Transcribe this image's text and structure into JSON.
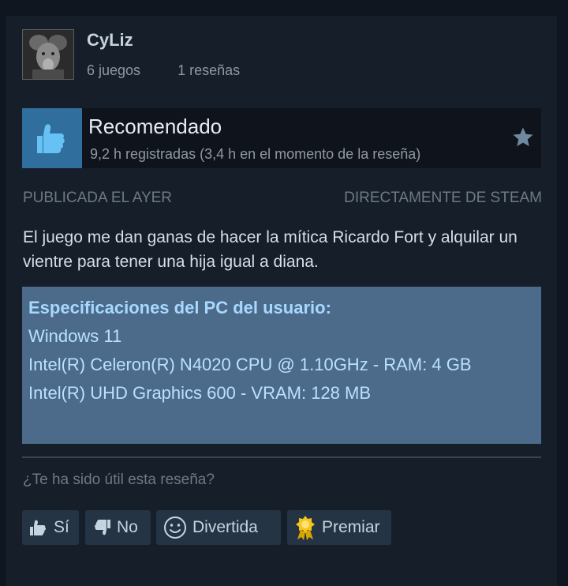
{
  "user": {
    "name": "CyLiz",
    "games": "6 juegos",
    "reviews": "1 reseñas"
  },
  "recommendation": {
    "title": "Recomendado",
    "hours": "9,2 h registradas (3,4 h en el momento de la reseña)",
    "accent_color": "#2f6e9d",
    "icon": "thumbs-up-icon"
  },
  "meta": {
    "published": "PUBLICADA EL AYER",
    "source": "DIRECTAMENTE DE STEAM"
  },
  "review_text": "El juego me dan ganas de hacer la mítica Ricardo Fort y alquilar un vientre para tener una hija igual a diana.",
  "specs": {
    "heading": "Especificaciones del PC del usuario:",
    "os": "Windows 11",
    "cpu": "Intel(R) Celeron(R) N4020 CPU @ 1.10GHz - RAM: 4 GB",
    "gpu": "Intel(R) UHD Graphics 600 - VRAM: 128 MB",
    "background_color": "#4c6b8a"
  },
  "feedback": {
    "question": "¿Te ha sido útil esta reseña?",
    "yes_label": "Sí",
    "no_label": "No",
    "funny_label": "Divertida",
    "award_label": "Premiar"
  }
}
